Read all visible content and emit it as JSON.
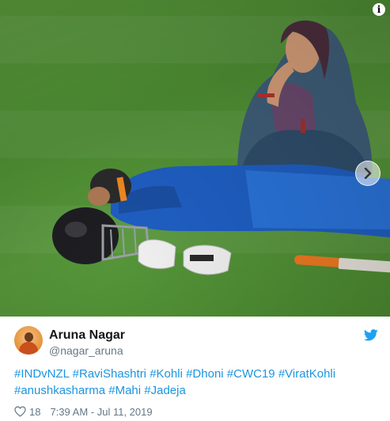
{
  "media": {
    "alt_icons": [
      "info-icon",
      "chevron-right-icon"
    ]
  },
  "user": {
    "name": "Aruna Nagar",
    "handle": "@nagar_aruna"
  },
  "tweet": {
    "hashtags_line1": [
      "#INDvNZL",
      "#RaviShashtri",
      "#Kohli",
      "#Dhoni",
      "#CWC19",
      "#ViratKohli"
    ],
    "hashtags_line2": [
      "#anushkasharma",
      "#Mahi",
      "#Jadeja"
    ],
    "likes": "18",
    "timestamp": "7:39 AM - Jul 11, 2019"
  },
  "colors": {
    "link": "#1b95e0",
    "muted": "#657786",
    "name": "#14171a",
    "twitter_blue": "#1da1f2"
  },
  "info_glyph": "i"
}
